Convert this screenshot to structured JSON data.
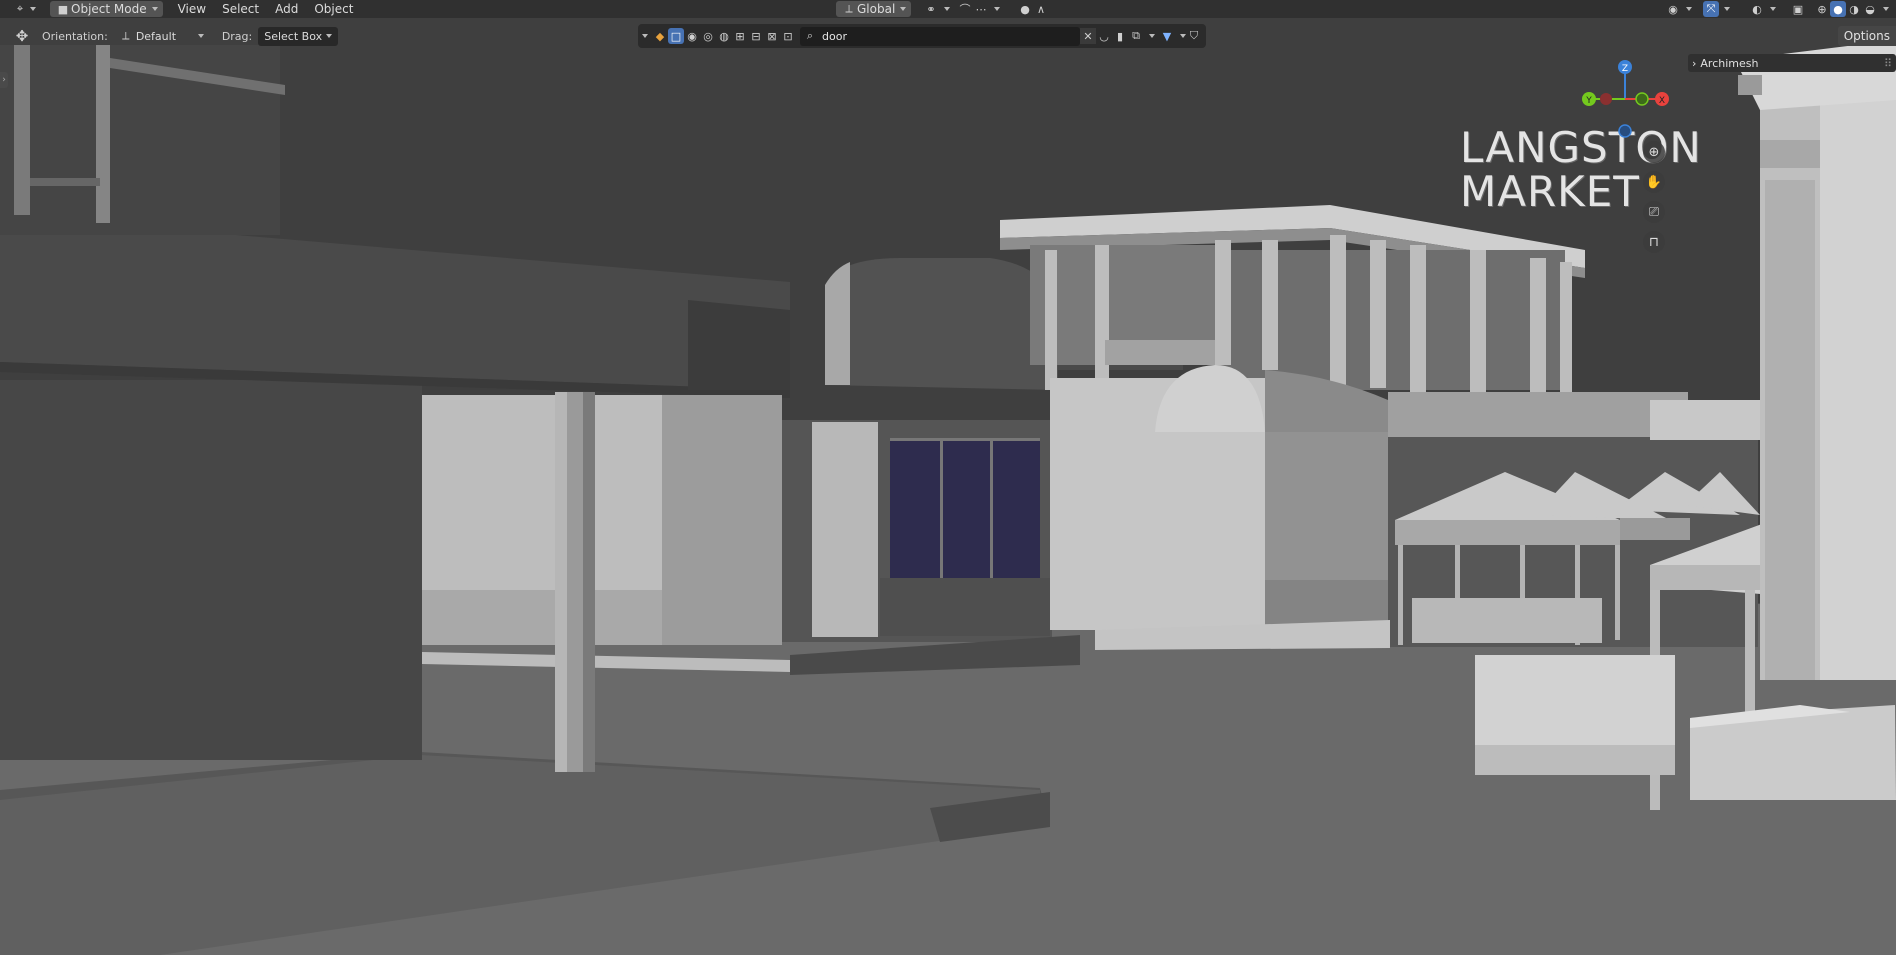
{
  "header": {
    "mode": "Object Mode",
    "menu": [
      "View",
      "Select",
      "Add",
      "Object"
    ],
    "transform_orientation": "Global"
  },
  "tool_settings": {
    "orientation_label": "Orientation:",
    "orientation_value": "Default",
    "drag_label": "Drag:",
    "drag_value": "Select Box"
  },
  "outliner_search": {
    "value": "door"
  },
  "options_label": "Options",
  "npanel": {
    "tab_label": "Archimesh"
  },
  "gizmo": {
    "z": "Z",
    "y": "Y",
    "x": "X"
  },
  "scene": {
    "sign_line1": "LANGSTON",
    "sign_line2": "MARKET"
  },
  "colors": {
    "accent": "#4772b3",
    "header_bg": "#303030",
    "viewport_bg": "#3d3d3d",
    "axis_x": "#e8423d",
    "axis_y": "#74c91e",
    "axis_z": "#3b82d9",
    "window_glass": "#2e2c4e"
  },
  "icons": [
    "editor-type-icon",
    "object-mode-icon",
    "transform-orientation-icon",
    "pivot-icon",
    "snap-icon",
    "proportional-edit-icon",
    "move-tool-icon",
    "search-icon",
    "clear-icon",
    "filter-icon",
    "visibility-icon",
    "gizmo-icon",
    "overlay-icon",
    "xray-icon",
    "shading-wireframe-icon",
    "shading-solid-icon",
    "shading-material-icon",
    "shading-rendered-icon",
    "zoom-icon",
    "hand-icon",
    "camera-icon",
    "lock-icon"
  ]
}
